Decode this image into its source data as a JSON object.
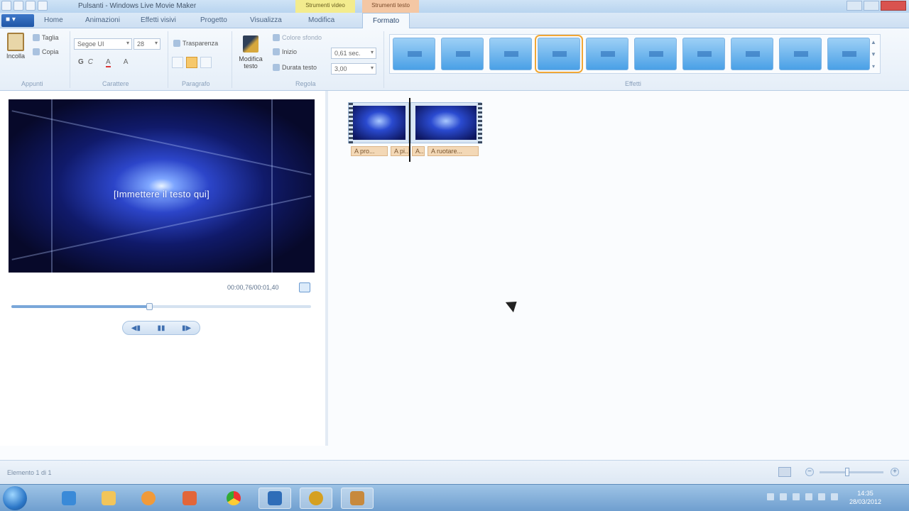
{
  "window": {
    "title": "Pulsanti - Windows Live Movie Maker",
    "context_tab_1": "Strumenti video",
    "context_tab_2": "Strumenti testo"
  },
  "tabs": {
    "app_menu": "■ ▾",
    "items": [
      "Home",
      "Animazioni",
      "Effetti visivi",
      "Progetto",
      "Visualizza",
      "Modifica"
    ],
    "active": "Formato"
  },
  "ribbon": {
    "clipboard": {
      "paste": "Incolla",
      "cut": "Taglia",
      "copy": "Copia",
      "label": "Appunti"
    },
    "font": {
      "family": "Segoe UI",
      "size": "28",
      "bold": "G",
      "italic": "C",
      "color": "A",
      "grow": "A",
      "label": "Carattere"
    },
    "paragraph": {
      "transparency": "Trasparenza",
      "label": "Paragrafo"
    },
    "adjust": {
      "edit_text": "Modifica testo",
      "bg_color": "Colore sfondo",
      "start_time": "Inizio",
      "start_value": "0,61 sec.",
      "duration": "Durata testo",
      "duration_value": "3,00",
      "label": "Regola"
    },
    "effects": {
      "label": "Effetti",
      "selected_index": 3
    }
  },
  "preview": {
    "overlay_text": "[Immettere il testo qui]",
    "timecode": "00:00,76/00:01,40",
    "progress": 0.46
  },
  "storyboard": {
    "clips": [
      {
        "caption": "A pro..."
      },
      {
        "caption": "A pi..."
      },
      {
        "caption": "A..."
      },
      {
        "caption": "A ruotare..."
      }
    ]
  },
  "status": {
    "text": "Elemento 1 di 1"
  },
  "taskbar": {
    "clock_time": "14:35",
    "clock_date": "28/03/2012"
  },
  "colors": {
    "ribbon_bg": "#f5f9fd",
    "effect_thumb": "#4aa0e6",
    "selection": "#f0a736",
    "caption_bg": "#f3d8b6",
    "taskbar": "#6f9fcf"
  }
}
